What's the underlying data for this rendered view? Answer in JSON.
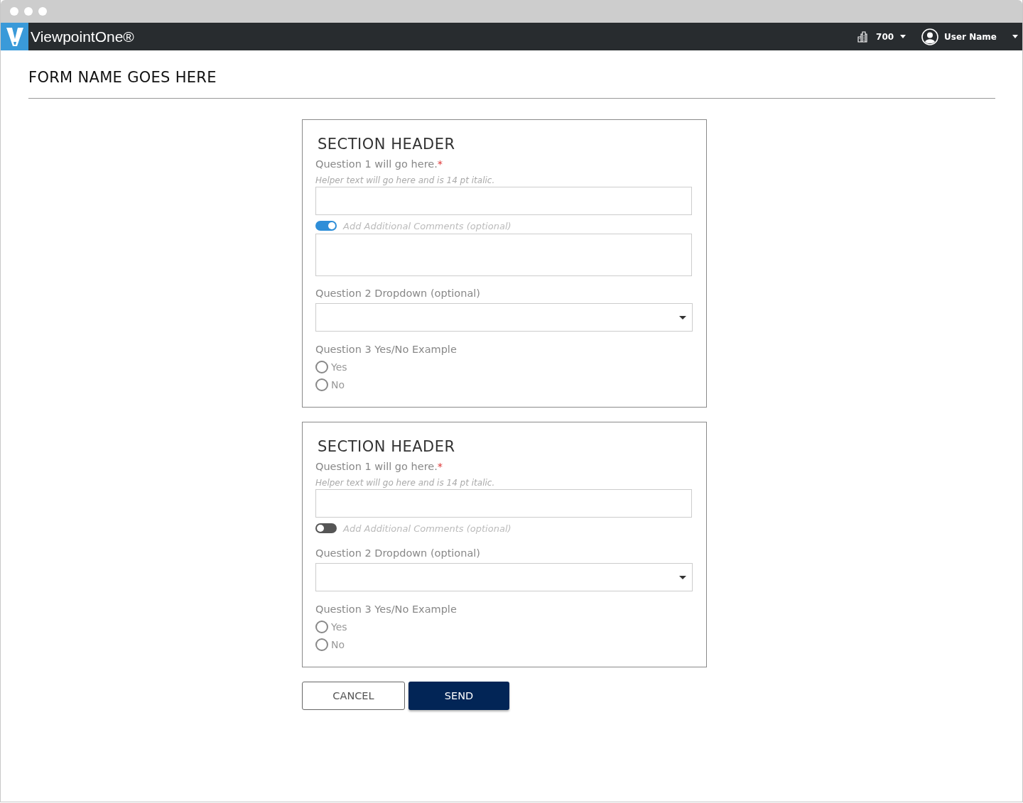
{
  "app": {
    "brand": "ViewpointOne®",
    "company": "700",
    "user": "User Name"
  },
  "form": {
    "title": "FORM NAME GOES HERE"
  },
  "sections": [
    {
      "header": "SECTION HEADER",
      "question1": {
        "label": "Question 1 will go here.",
        "required_mark": "*",
        "helper": "Helper text will go here and is 14 pt italic."
      },
      "comments": {
        "label": "Add Additional Comments (optional)",
        "on": true
      },
      "question2": {
        "label": "Question 2 Dropdown (optional)"
      },
      "question3": {
        "label": "Question 3 Yes/No Example",
        "options": [
          {
            "label": "Yes",
            "selected": false
          },
          {
            "label": "No",
            "selected": false
          }
        ]
      }
    },
    {
      "header": "SECTION HEADER",
      "question1": {
        "label": "Question 1 will go here.",
        "required_mark": "*",
        "helper": "Helper text will go here and is 14 pt italic."
      },
      "comments": {
        "label": "Add Additional Comments (optional)",
        "on": false
      },
      "question2": {
        "label": "Question 2 Dropdown (optional)"
      },
      "question3": {
        "label": "Question 3 Yes/No Example",
        "options": [
          {
            "label": "Yes",
            "selected": false
          },
          {
            "label": "No",
            "selected": false
          }
        ]
      }
    }
  ],
  "buttons": [
    {
      "label": "CANCEL",
      "kind": "secondary"
    },
    {
      "label": "SEND",
      "kind": "primary"
    }
  ]
}
